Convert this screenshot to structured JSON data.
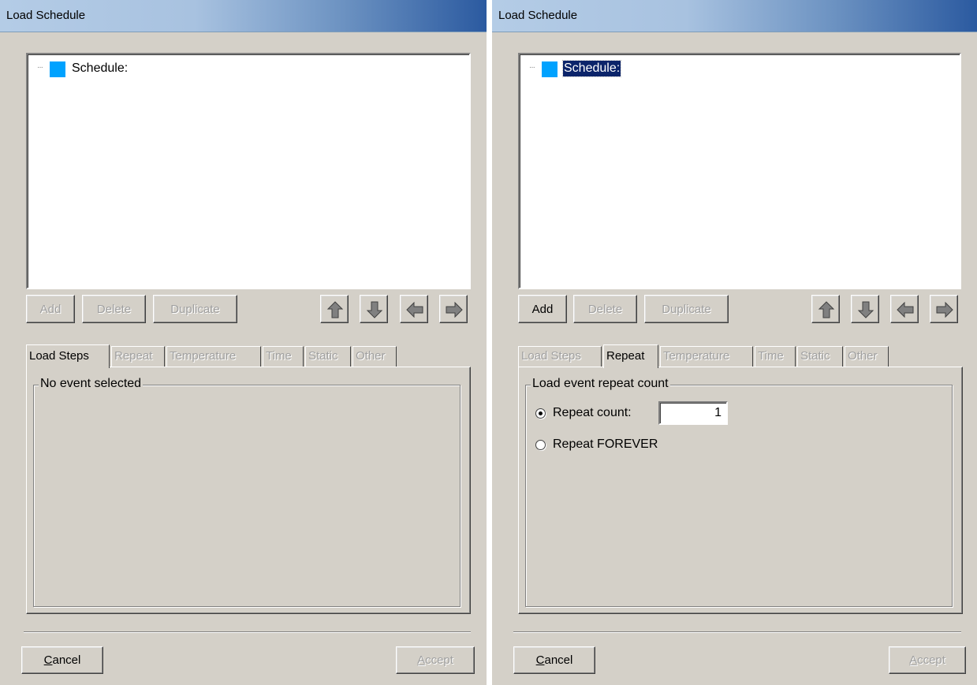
{
  "dialogs": [
    {
      "title": "Load Schedule",
      "tree": {
        "node_label": "Schedule:",
        "selected": false
      },
      "buttons": {
        "add": "Add",
        "delete": "Delete",
        "duplicate": "Duplicate",
        "cancel": "Cancel",
        "accept": "Accept"
      },
      "tabs": [
        "Load Steps",
        "Repeat",
        "Temperature",
        "Time",
        "Static",
        "Other"
      ],
      "active_tab": "Load Steps",
      "panel": {
        "group_title": "No event selected"
      }
    },
    {
      "title": "Load Schedule",
      "tree": {
        "node_label": "Schedule:",
        "selected": true
      },
      "buttons": {
        "add": "Add",
        "delete": "Delete",
        "duplicate": "Duplicate",
        "cancel": "Cancel",
        "accept": "Accept"
      },
      "tabs": [
        "Load Steps",
        "Repeat",
        "Temperature",
        "Time",
        "Static",
        "Other"
      ],
      "active_tab": "Repeat",
      "panel": {
        "group_title": "Load event repeat count",
        "repeat_count_label": "Repeat count:",
        "repeat_count_value": "1",
        "repeat_forever_label": "Repeat FOREVER",
        "selected_option": "repeat_count"
      }
    }
  ],
  "icons": [
    "arrow-up-icon",
    "arrow-down-icon",
    "arrow-left-icon",
    "arrow-right-icon"
  ],
  "colors": {
    "tree_node_icon": "#00a2ff",
    "selection": "#0b246a",
    "dialog_bg": "#d4d0c8"
  }
}
